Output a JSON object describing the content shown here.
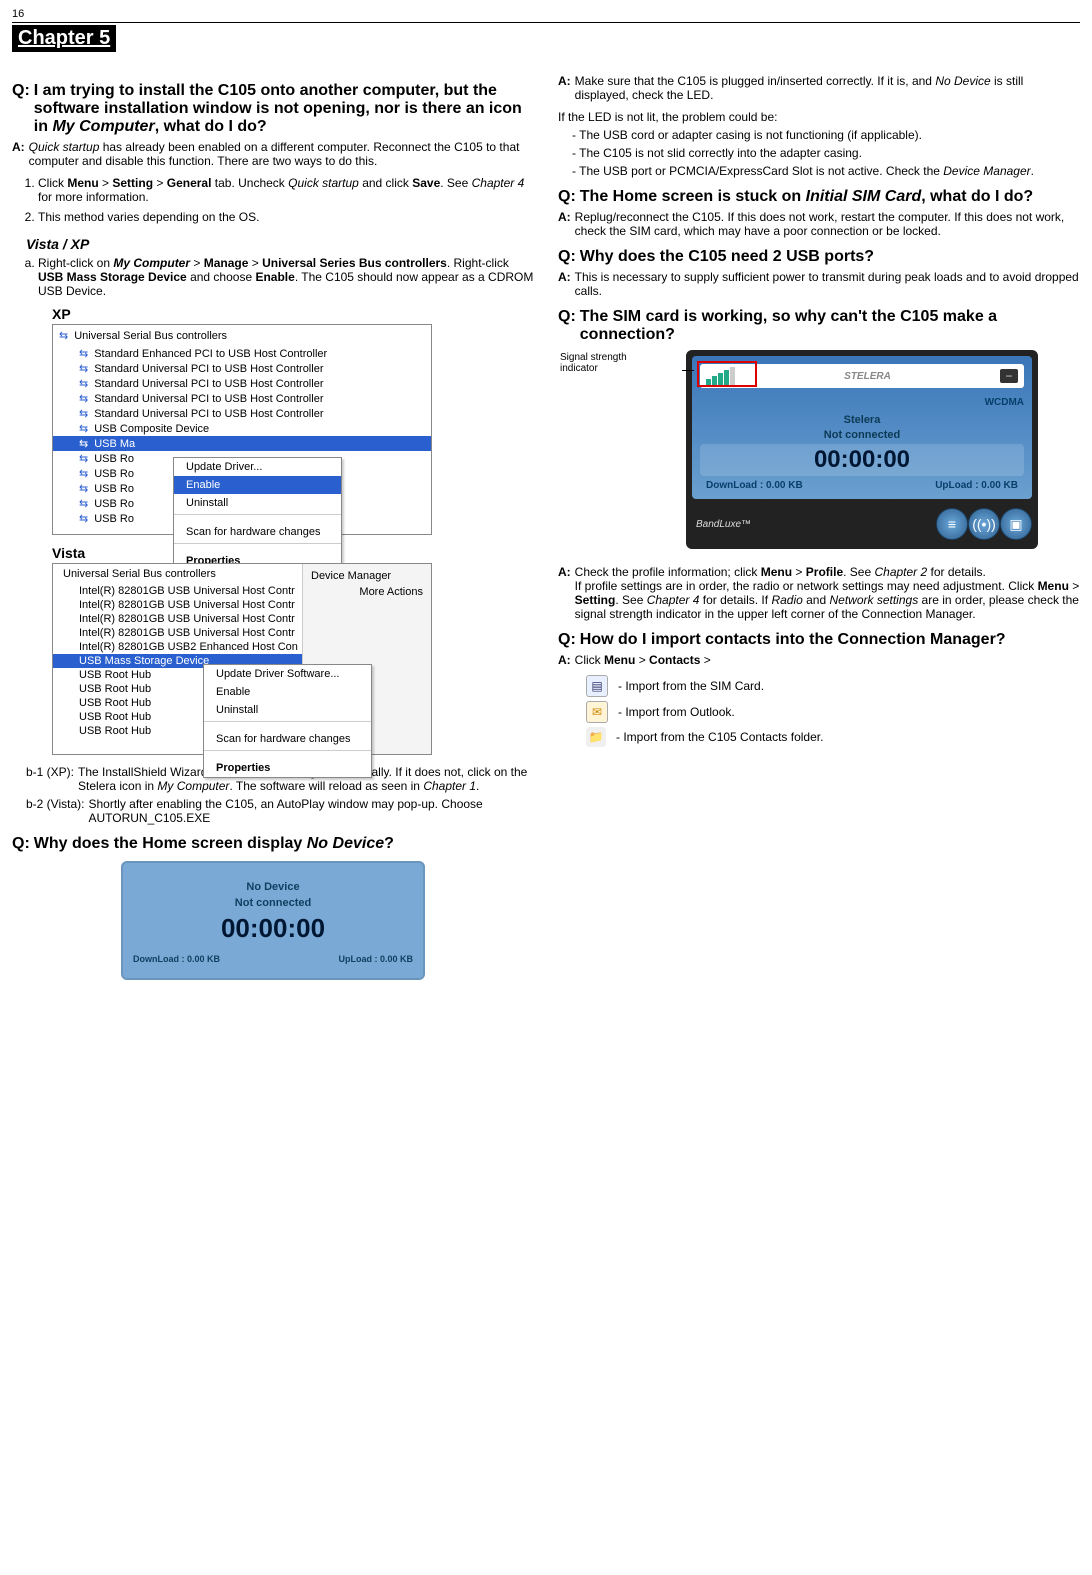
{
  "page_number": "16",
  "chapter_title": "Chapter 5",
  "left": {
    "q1": {
      "label": "Q:",
      "text_a": "I am trying to install the C105 onto another computer, but the software installation window is not opening, nor is there an icon in ",
      "text_b": "My Computer",
      "text_c": ", what do I do?"
    },
    "a1": {
      "label": "A:",
      "lead_i": "Quick startup",
      "lead_rest": " has already been enabled on a different computer. Reconnect the C105 to that computer and disable this function. There are two ways to do this."
    },
    "steps": {
      "s1_a": "Click ",
      "s1_menu": "Menu",
      "s1_gt1": " > ",
      "s1_setting": "Setting",
      "s1_gt2": " > ",
      "s1_general": "General",
      "s1_b": " tab. Uncheck ",
      "s1_qs": "Quick startup",
      "s1_c": " and click ",
      "s1_save": "Save",
      "s1_d": ". See ",
      "s1_ch4": "Chapter 4",
      "s1_e": " for more information.",
      "s2": "This method varies depending on the OS."
    },
    "vistaxp_heading": "Vista / XP",
    "step_a": {
      "a1": "Right-click on ",
      "a_mc": "My Computer",
      "a_gt1": " > ",
      "a_manage": "Manage",
      "a_gt2": " > ",
      "a_usb": "Universal Series Bus controllers",
      "a2": ". Right-click ",
      "a_msd": "USB Mass Storage Device",
      "a3": " and choose ",
      "a_enable": "Enable",
      "a4": ". The C105 should now appear as a CDROM USB Device."
    },
    "xp_label": "XP",
    "xp_shot": {
      "header": "Universal Serial Bus controllers",
      "items": [
        "Standard Enhanced PCI to USB Host Controller",
        "Standard Universal PCI to USB Host Controller",
        "Standard Universal PCI to USB Host Controller",
        "Standard Universal PCI to USB Host Controller",
        "Standard Universal PCI to USB Host Controller",
        "USB Composite Device"
      ],
      "selected": "USB Ma",
      "roots": [
        "USB Ro",
        "USB Ro",
        "USB Ro",
        "USB Ro",
        "USB Ro"
      ],
      "menu": [
        "Update Driver...",
        "Enable",
        "Uninstall",
        "Scan for hardware changes",
        "Properties"
      ],
      "menu_highlight_index": 1
    },
    "vista_label": "Vista",
    "vista_shot": {
      "header": "Universal Serial Bus controllers",
      "items": [
        "Intel(R) 82801GB USB Universal Host Contr",
        "Intel(R) 82801GB USB Universal Host Contr",
        "Intel(R) 82801GB USB Universal Host Contr",
        "Intel(R) 82801GB USB Universal Host Contr",
        "Intel(R) 82801GB USB2 Enhanced Host Con"
      ],
      "selected": "USB Mass Storage Device",
      "roots": [
        "USB Root Hub",
        "USB Root Hub",
        "USB Root Hub",
        "USB Root Hub",
        "USB Root Hub"
      ],
      "right_panel": [
        "Device Manager",
        "More Actions"
      ],
      "menu": [
        "Update Driver Software...",
        "Enable",
        "Uninstall",
        "Scan for hardware changes",
        "Properties"
      ]
    },
    "b1": {
      "label": "b-1 (XP):",
      "t1": "The InstallShield Wizard should start running automatically. If it does not, click on the Stelera icon in ",
      "t_mc": "My Computer",
      "t2": ". The software will reload as seen in ",
      "t_ch1": "Chapter 1",
      "t3": "."
    },
    "b2": {
      "label": "b-2 (Vista):",
      "text": "Shortly after enabling the C105, an AutoPlay window may pop-up. Choose AUTORUN_C105.EXE"
    },
    "q2": {
      "label": "Q:",
      "t1": "Why does the Home screen display ",
      "t_nd": "No Device",
      "t2": "?"
    },
    "home": {
      "l1": "No Device",
      "l2": "Not connected",
      "big": "00:00:00",
      "dl": "DownLoad : 0.00 KB",
      "ul": "UpLoad : 0.00 KB"
    }
  },
  "right": {
    "a_top": {
      "label": "A:",
      "t1": "Make sure that the C105 is plugged in/inserted correctly. If it is, and ",
      "t_nd": "No Device",
      "t2": " is still displayed, check the LED."
    },
    "led_intro": "If the LED is not lit, the problem could be:",
    "dash": {
      "d1": "The USB cord or adapter casing is not functioning (if applicable).",
      "d2": "The C105 is not slid correctly into the adapter casing.",
      "d3a": "The USB port or PCMCIA/ExpressCard Slot is not active. Check the ",
      "d3b": "Device Manager",
      "d3c": "."
    },
    "q3": {
      "label": "Q:",
      "t1": "The Home screen is stuck on ",
      "t_sim": "Initial SIM Card",
      "t2": ", what do I do?"
    },
    "a3": {
      "label": "A:",
      "text": "Replug/reconnect the C105. If this does not work, restart the computer. If this does not work, check the SIM card, which may have a poor connection or be locked."
    },
    "q4": {
      "label": "Q:",
      "text": "Why does the C105 need 2 USB ports?"
    },
    "a4": {
      "label": "A:",
      "text": "This is necessary to supply sufficient power to transmit during peak loads and to avoid dropped calls."
    },
    "q5": {
      "label": "Q:",
      "text": "The SIM card is working, so why can't the C105 make a connection?"
    },
    "signal_label": "Signal strength indicator",
    "cm": {
      "logo": "STELERA",
      "net": "WCDMA",
      "op": "Stelera",
      "status": "Not connected",
      "time": "00:00:00",
      "dl": "DownLoad : 0.00 KB",
      "ul": "UpLoad : 0.00 KB",
      "brand": "BandLuxe™"
    },
    "a5": {
      "label": "A:",
      "p1a": "Check the profile information; click ",
      "p1_menu": "Menu",
      "p1_gt": " > ",
      "p1_profile": "Profile",
      "p1b": ". See ",
      "p1_ch2": "Chapter 2",
      "p1c": " for details.",
      "p2a": "If profile settings are in order, the radio or network settings may need adjustment. Click ",
      "p2_menu": "Menu",
      "p2_gt": " > ",
      "p2_setting": "Setting",
      "p2b": ". See ",
      "p2_ch4": "Chapter 4",
      "p2c": " for details. If ",
      "p2_radio": "Radio",
      "p2d": " and ",
      "p2_ns": "Network settings",
      "p2e": " are in order, please check the signal strength indicator in the upper left corner of the Connection Manager."
    },
    "q6": {
      "label": "Q:",
      "text": "How do I import contacts into the Connection Manager?"
    },
    "a6": {
      "label": "A:",
      "t1": "Click ",
      "t_menu": "Menu",
      "t_gt": " > ",
      "t_contacts": "Contacts",
      "t2": " >"
    },
    "imports": {
      "sim": "- Import from the SIM Card.",
      "outlook": "- Import from Outlook.",
      "folder": "- Import from the C105 Contacts folder."
    }
  }
}
